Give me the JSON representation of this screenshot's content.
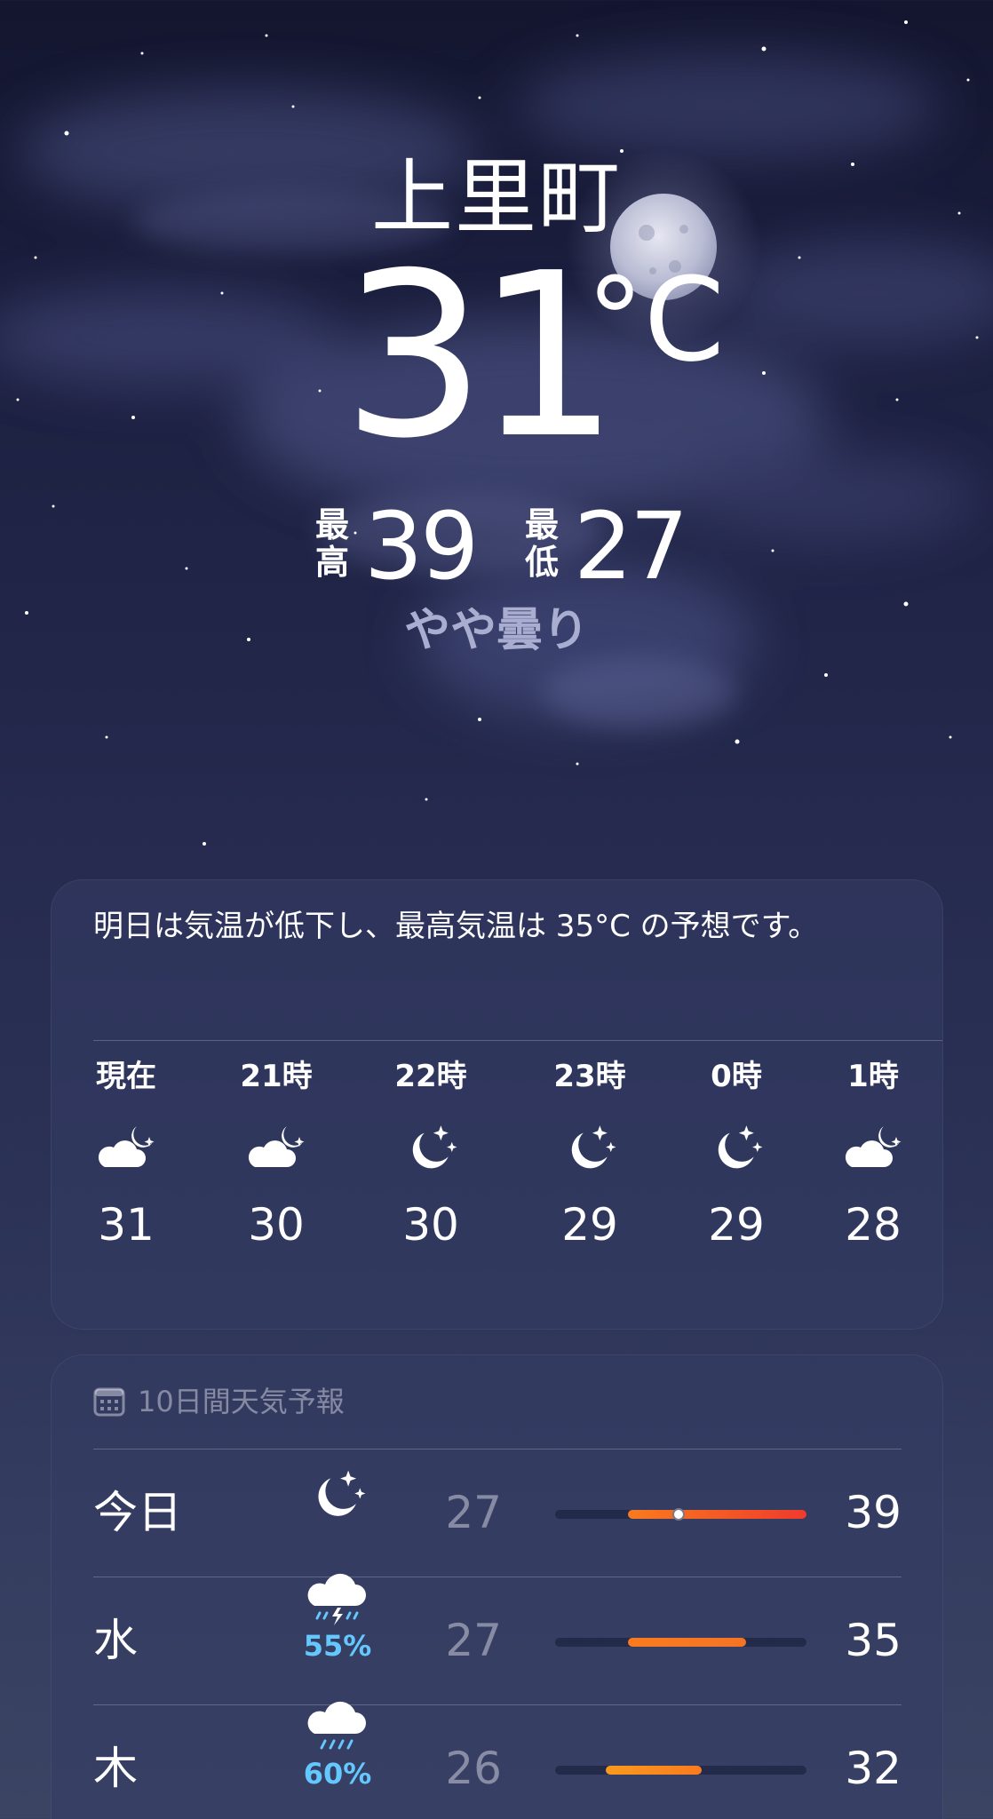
{
  "location": {
    "city": "上里町",
    "temperature": "31",
    "unit": "°C",
    "high_label": "最高",
    "high": "39",
    "low_label": "最低",
    "low": "27",
    "condition": "やや曇り"
  },
  "hourly_card": {
    "summary": "明日は気温が低下し、最高気温は 35°C の予想です。",
    "hours": [
      {
        "label": "現在",
        "icon": "cloud-moon-icon",
        "temp": "31"
      },
      {
        "label": "21時",
        "icon": "cloud-moon-icon",
        "temp": "30"
      },
      {
        "label": "22時",
        "icon": "moon-stars-icon",
        "temp": "30"
      },
      {
        "label": "23時",
        "icon": "moon-stars-icon",
        "temp": "29"
      },
      {
        "label": "0時",
        "icon": "moon-stars-icon",
        "temp": "29"
      },
      {
        "label": "1時",
        "icon": "cloud-moon-icon",
        "temp": "28"
      }
    ]
  },
  "forecast_card": {
    "title": "10日間天気予報",
    "title_icon": "calendar-icon",
    "days": [
      {
        "day": "今日",
        "icon": "moon-stars-icon",
        "precip": "",
        "low": "27",
        "high": "39",
        "range_start": 0.29,
        "range_end": 1.0,
        "current": 0.49,
        "colors": [
          "#f97b1e",
          "#ef3b2c"
        ]
      },
      {
        "day": "水",
        "icon": "cloud-bolt-rain-icon",
        "precip": "55%",
        "low": "27",
        "high": "35",
        "range_start": 0.29,
        "range_end": 0.76,
        "colors": [
          "#f97b1e",
          "#f47425"
        ]
      },
      {
        "day": "木",
        "icon": "cloud-rain-icon",
        "precip": "60%",
        "low": "26",
        "high": "32",
        "range_start": 0.2,
        "range_end": 0.58,
        "colors": [
          "#f99a1e",
          "#f97b1e"
        ]
      }
    ]
  },
  "colors": {
    "precip_blue": "#64c8ff",
    "secondary_text": "#a9add0"
  }
}
